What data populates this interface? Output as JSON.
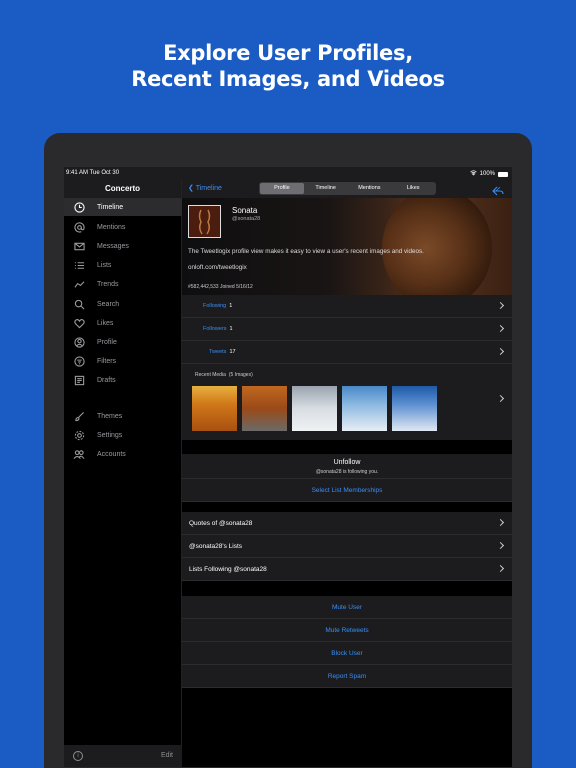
{
  "headline": [
    "Explore User Profiles,",
    "Recent Images, and Videos"
  ],
  "status": {
    "time": "9:41 AM  Tue Oct 30",
    "battery": "100%"
  },
  "sidebar": {
    "title": "Concerto",
    "items": [
      {
        "label": "Timeline",
        "icon": "clock-icon"
      },
      {
        "label": "Mentions",
        "icon": "at-icon"
      },
      {
        "label": "Messages",
        "icon": "envelope-icon"
      },
      {
        "label": "Lists",
        "icon": "list-icon"
      },
      {
        "label": "Trends",
        "icon": "trend-icon"
      },
      {
        "label": "Search",
        "icon": "search-icon"
      },
      {
        "label": "Likes",
        "icon": "heart-icon"
      },
      {
        "label": "Profile",
        "icon": "person-icon"
      },
      {
        "label": "Filters",
        "icon": "filter-icon"
      },
      {
        "label": "Drafts",
        "icon": "drafts-icon"
      },
      {
        "label": "Themes",
        "icon": "brush-icon"
      },
      {
        "label": "Settings",
        "icon": "gear-icon"
      },
      {
        "label": "Accounts",
        "icon": "accounts-icon"
      }
    ],
    "edit": "Edit"
  },
  "nav": {
    "back": "Timeline",
    "segments": [
      "Profile",
      "Timeline",
      "Mentions",
      "Likes"
    ]
  },
  "profile": {
    "name": "Sonata",
    "handle": "@sonata28",
    "bio": "The Tweetlogix profile view makes it easy to view a user's recent images and videos.",
    "link": "onloft.com/tweetlogix",
    "meta": "#582,442,533  Joined 5/16/12"
  },
  "stats": [
    {
      "label": "Following",
      "value": "1"
    },
    {
      "label": "Followers",
      "value": "1"
    },
    {
      "label": "Tweets",
      "value": "17"
    }
  ],
  "media": {
    "title": "Recent Media",
    "count": "(5 Images)"
  },
  "follow": {
    "action": "Unfollow",
    "note": "@sonata28 is following you.",
    "memberships": "Select List Memberships"
  },
  "links": [
    "Quotes of @sonata28",
    "@sonata28's Lists",
    "Lists Following @sonata28"
  ],
  "actions": [
    "Mute User",
    "Mute Retweets",
    "Block User",
    "Report Spam"
  ],
  "colors": {
    "accent": "#3a8ef6",
    "background": "#1a5bc4"
  }
}
